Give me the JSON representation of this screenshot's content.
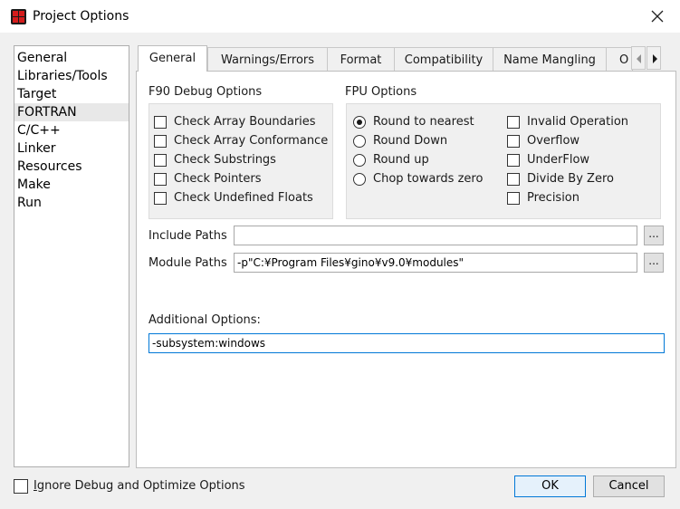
{
  "window": {
    "title": "Project Options",
    "accent": "#0078d7"
  },
  "categories": [
    "General",
    "Libraries/Tools",
    "Target",
    "FORTRAN",
    "C/C++",
    "Linker",
    "Resources",
    "Make",
    "Run"
  ],
  "selected_category": "FORTRAN",
  "tabs": [
    "General",
    "Warnings/Errors",
    "Format",
    "Compatibility",
    "Name Mangling",
    "O"
  ],
  "active_tab": "General",
  "f90": {
    "title": "F90 Debug Options",
    "options": [
      {
        "label": "Check Array Boundaries",
        "checked": false
      },
      {
        "label": "Check Array Conformance",
        "checked": false
      },
      {
        "label": "Check Substrings",
        "checked": false
      },
      {
        "label": "Check Pointers",
        "checked": false
      },
      {
        "label": "Check Undefined Floats",
        "checked": false
      }
    ]
  },
  "fpu": {
    "title": "FPU Options",
    "rounding": [
      {
        "label": "Round to nearest",
        "selected": true
      },
      {
        "label": "Round Down",
        "selected": false
      },
      {
        "label": "Round up",
        "selected": false
      },
      {
        "label": "Chop towards zero",
        "selected": false
      }
    ],
    "exceptions": [
      {
        "label": "Invalid Operation",
        "checked": false
      },
      {
        "label": "Overflow",
        "checked": false
      },
      {
        "label": "UnderFlow",
        "checked": false
      },
      {
        "label": "Divide By Zero",
        "checked": false
      },
      {
        "label": "Precision",
        "checked": false
      }
    ]
  },
  "paths": {
    "include_label": "Include Paths",
    "include_value": "",
    "module_label": "Module Paths",
    "module_value": "-p\"C:¥Program Files¥gino¥v9.0¥modules\"",
    "browse": "..."
  },
  "additional": {
    "label": "Additional Options:",
    "value": "-subsystem:windows"
  },
  "footer": {
    "ignore_prefix": "I",
    "ignore_rest": "gnore Debug and Optimize Options",
    "ignore_checked": false,
    "ok": "OK",
    "cancel": "Cancel"
  }
}
